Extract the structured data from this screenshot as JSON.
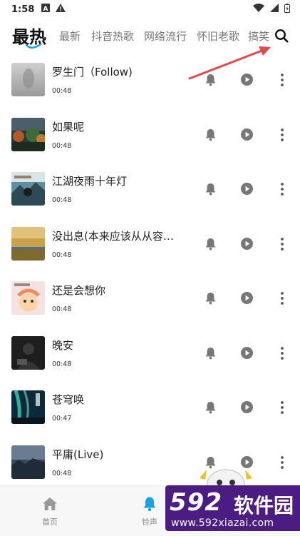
{
  "status_bar": {
    "time": "1:58"
  },
  "tabs": {
    "active": "最热",
    "items": [
      "最新",
      "抖音热歌",
      "网络流行",
      "怀旧老歌",
      "搞笑"
    ]
  },
  "songs": [
    {
      "title": "罗生门（Follow)",
      "duration": "00:48"
    },
    {
      "title": "如果呢",
      "duration": "00:48"
    },
    {
      "title": "江湖夜雨十年灯",
      "duration": "00:48"
    },
    {
      "title": "没出息(本来应该从从容容...",
      "duration": "00:48"
    },
    {
      "title": "还是会想你",
      "duration": "00:48"
    },
    {
      "title": "晚安",
      "duration": "00:48"
    },
    {
      "title": "苍穹唤",
      "duration": "00:47"
    },
    {
      "title": "平庸(Live)",
      "duration": "00:48"
    }
  ],
  "bottom_nav": {
    "home_label": "首页",
    "ringtone_label": "铃声"
  },
  "watermark": {
    "logo_number": "592",
    "logo_text": "软件园",
    "url": "www.592xiazai.com"
  },
  "colors": {
    "accent_blue": "#1aa0e6",
    "icon_gray": "#777777",
    "watermark_purple": "#4b1d83",
    "annotation_red": "#e04a4a"
  }
}
